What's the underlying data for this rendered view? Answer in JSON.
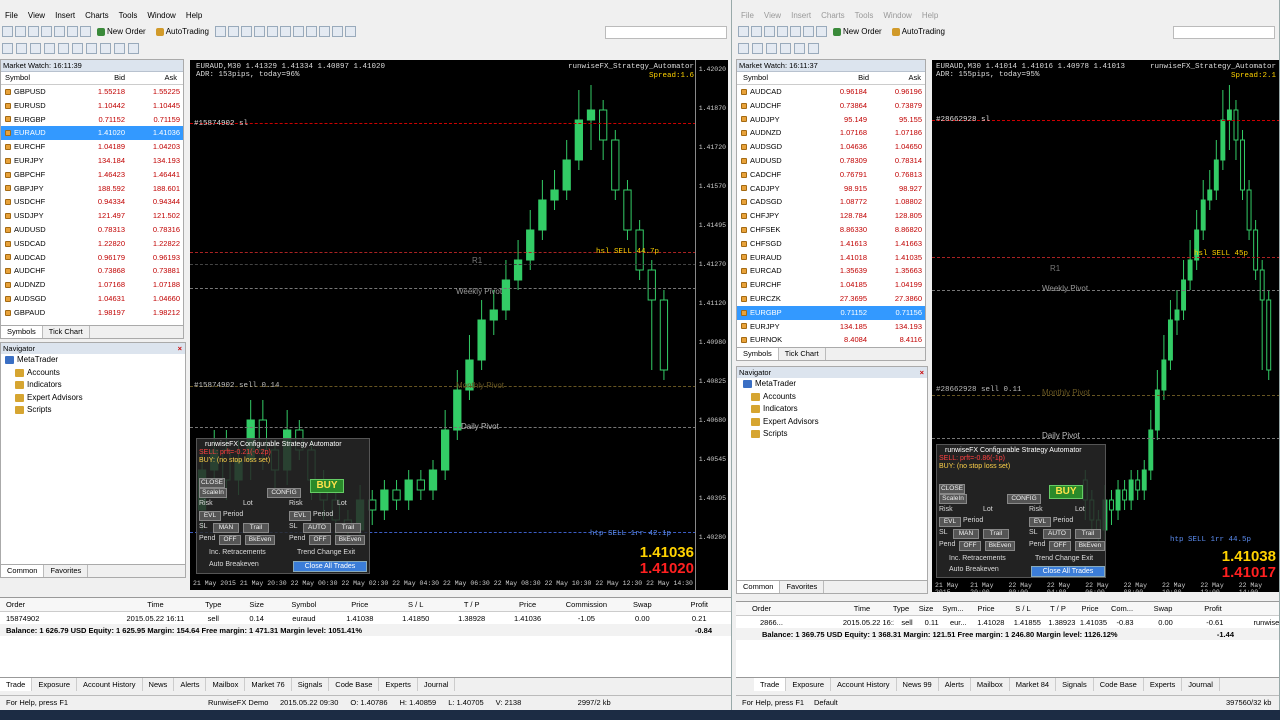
{
  "menu": [
    "File",
    "View",
    "Insert",
    "Charts",
    "Tools",
    "Window",
    "Help"
  ],
  "toolbar": {
    "new_order": "New Order",
    "autotrading": "AutoTrading"
  },
  "left": {
    "market_watch_title": "Market Watch: 16:11:39",
    "columns": {
      "symbol": "Symbol",
      "bid": "Bid",
      "ask": "Ask"
    },
    "rows": [
      {
        "s": "GBPUSD",
        "b": "1.55218",
        "a": "1.55225"
      },
      {
        "s": "EURUSD",
        "b": "1.10442",
        "a": "1.10445"
      },
      {
        "s": "EURGBP",
        "b": "0.71152",
        "a": "0.71159"
      },
      {
        "s": "EURAUD",
        "b": "1.41020",
        "a": "1.41036"
      },
      {
        "s": "EURCHF",
        "b": "1.04189",
        "a": "1.04203"
      },
      {
        "s": "EURJPY",
        "b": "134.184",
        "a": "134.193"
      },
      {
        "s": "GBPCHF",
        "b": "1.46423",
        "a": "1.46441"
      },
      {
        "s": "GBPJPY",
        "b": "188.592",
        "a": "188.601"
      },
      {
        "s": "USDCHF",
        "b": "0.94334",
        "a": "0.94344"
      },
      {
        "s": "USDJPY",
        "b": "121.497",
        "a": "121.502"
      },
      {
        "s": "AUDUSD",
        "b": "0.78313",
        "a": "0.78316"
      },
      {
        "s": "USDCAD",
        "b": "1.22820",
        "a": "1.22822"
      },
      {
        "s": "AUDCAD",
        "b": "0.96179",
        "a": "0.96193"
      },
      {
        "s": "AUDCHF",
        "b": "0.73868",
        "a": "0.73881"
      },
      {
        "s": "AUDNZD",
        "b": "1.07168",
        "a": "1.07188"
      },
      {
        "s": "AUDSGD",
        "b": "1.04631",
        "a": "1.04660"
      },
      {
        "s": "GBPAUD",
        "b": "1.98197",
        "a": "1.98212"
      }
    ],
    "tabs": [
      "Symbols",
      "Tick Chart"
    ],
    "navigator_title": "Navigator",
    "nav_items": [
      "MetaTrader",
      "Accounts",
      "Indicators",
      "Expert Advisors",
      "Scripts"
    ],
    "chart": {
      "header": "EURAUD,M30  1.41329 1.41334 1.40897 1.41020",
      "adr": "ADR: 153pips, today=96%",
      "ea": "runwiseFX_Strategy_Automator",
      "spread": "Spread:1.6",
      "order_lbl": "#15874902 sl",
      "hsl": "hsl SELL 44.7p",
      "htp": "htp SELL 1rr 42.1p",
      "r1": "R1",
      "weekly": "Weekly Pivot",
      "monthly": "Monthly Pivot",
      "daily": "Daily Pivot",
      "ask_big": "1.41036",
      "bid_big": "1.41020",
      "mini_lbl": "#15874902 sell 0.14",
      "axis": [
        "1.42020",
        "1.41870",
        "1.41720",
        "1.41570",
        "1.41495",
        "1.41270",
        "1.41120",
        "1.40980",
        "1.40825",
        "1.40680",
        "1.40545",
        "1.40395",
        "1.40280"
      ],
      "times": [
        "21 May 2015",
        "21 May 20:30",
        "22 May 00:30",
        "22 May 02:30",
        "22 May 04:30",
        "22 May 06:30",
        "22 May 08:30",
        "22 May 10:30",
        "22 May 12:30",
        "22 May 14:30"
      ],
      "candles": [
        {
          "o": 0.9,
          "c": 0.82,
          "h": 0.78,
          "l": 0.94
        },
        {
          "o": 0.82,
          "c": 0.78,
          "h": 0.74,
          "l": 0.86
        },
        {
          "o": 0.78,
          "c": 0.84,
          "h": 0.74,
          "l": 0.88
        },
        {
          "o": 0.84,
          "c": 0.8,
          "h": 0.76,
          "l": 0.87
        },
        {
          "o": 0.8,
          "c": 0.72,
          "h": 0.68,
          "l": 0.84
        },
        {
          "o": 0.72,
          "c": 0.78,
          "h": 0.68,
          "l": 0.82
        },
        {
          "o": 0.78,
          "c": 0.82,
          "h": 0.76,
          "l": 0.86
        },
        {
          "o": 0.82,
          "c": 0.74,
          "h": 0.7,
          "l": 0.85
        },
        {
          "o": 0.74,
          "c": 0.78,
          "h": 0.72,
          "l": 0.8
        },
        {
          "o": 0.78,
          "c": 0.84,
          "h": 0.76,
          "l": 0.88
        },
        {
          "o": 0.84,
          "c": 0.88,
          "h": 0.82,
          "l": 0.92
        },
        {
          "o": 0.88,
          "c": 0.92,
          "h": 0.86,
          "l": 0.95
        },
        {
          "o": 0.92,
          "c": 0.94,
          "h": 0.9,
          "l": 0.97
        },
        {
          "o": 0.94,
          "c": 0.88,
          "h": 0.85,
          "l": 0.96
        },
        {
          "o": 0.88,
          "c": 0.9,
          "h": 0.86,
          "l": 0.93
        },
        {
          "o": 0.9,
          "c": 0.86,
          "h": 0.84,
          "l": 0.92
        },
        {
          "o": 0.86,
          "c": 0.88,
          "h": 0.84,
          "l": 0.9
        },
        {
          "o": 0.88,
          "c": 0.84,
          "h": 0.82,
          "l": 0.9
        },
        {
          "o": 0.84,
          "c": 0.86,
          "h": 0.82,
          "l": 0.88
        },
        {
          "o": 0.86,
          "c": 0.82,
          "h": 0.8,
          "l": 0.88
        },
        {
          "o": 0.82,
          "c": 0.74,
          "h": 0.7,
          "l": 0.84
        },
        {
          "o": 0.74,
          "c": 0.66,
          "h": 0.62,
          "l": 0.76
        },
        {
          "o": 0.66,
          "c": 0.6,
          "h": 0.55,
          "l": 0.68
        },
        {
          "o": 0.6,
          "c": 0.52,
          "h": 0.48,
          "l": 0.62
        },
        {
          "o": 0.52,
          "c": 0.5,
          "h": 0.46,
          "l": 0.55
        },
        {
          "o": 0.5,
          "c": 0.44,
          "h": 0.4,
          "l": 0.52
        },
        {
          "o": 0.44,
          "c": 0.4,
          "h": 0.36,
          "l": 0.46
        },
        {
          "o": 0.4,
          "c": 0.34,
          "h": 0.3,
          "l": 0.42
        },
        {
          "o": 0.34,
          "c": 0.28,
          "h": 0.24,
          "l": 0.36
        },
        {
          "o": 0.28,
          "c": 0.26,
          "h": 0.22,
          "l": 0.3
        },
        {
          "o": 0.26,
          "c": 0.2,
          "h": 0.16,
          "l": 0.28
        },
        {
          "o": 0.2,
          "c": 0.12,
          "h": 0.06,
          "l": 0.22
        },
        {
          "o": 0.12,
          "c": 0.1,
          "h": 0.05,
          "l": 0.18
        },
        {
          "o": 0.1,
          "c": 0.16,
          "h": 0.08,
          "l": 0.2
        },
        {
          "o": 0.16,
          "c": 0.26,
          "h": 0.14,
          "l": 0.28
        },
        {
          "o": 0.26,
          "c": 0.34,
          "h": 0.24,
          "l": 0.36
        },
        {
          "o": 0.34,
          "c": 0.42,
          "h": 0.32,
          "l": 0.44
        },
        {
          "o": 0.42,
          "c": 0.48,
          "h": 0.4,
          "l": 0.62
        },
        {
          "o": 0.48,
          "c": 0.62,
          "h": 0.46,
          "l": 0.64
        }
      ],
      "panel": {
        "title": "runwiseFX Configurable Strategy Automator",
        "sell": "SELL: prft=-0.21(-0.2p)",
        "buy": "BUY: (no stop loss set)",
        "buy_btn": "BUY",
        "close": "CLOSE",
        "config": "CONFIG",
        "scalein": "ScaleIn",
        "risk": "Risk",
        "lot": "Lot",
        "evl": "EVL",
        "period": "Period",
        "sl": "SL",
        "man": "MAN",
        "auto": "AUTO",
        "trail": "Trail",
        "pend": "Pend",
        "off": "OFF",
        "bkeven": "BkEven",
        "inc": "Inc. Retracements",
        "trend": "Trend Change Exit",
        "auto_be": "Auto Breakeven",
        "close_all": "Close All Trades"
      }
    },
    "chart_tabs": [
      "Common",
      "Favorites"
    ],
    "terminal": {
      "cols": [
        "Order",
        "Time",
        "Type",
        "Size",
        "Symbol",
        "Price",
        "S / L",
        "T / P",
        "Price",
        "Commission",
        "Swap",
        "Profit"
      ],
      "row": [
        "15874902",
        "2015.05.22 16:11",
        "sell",
        "0.14",
        "euraud",
        "1.41038",
        "1.41850",
        "1.38928",
        "1.41036",
        "-1.05",
        "0.00",
        "0.21"
      ],
      "balance": "Balance: 1 626.79 USD  Equity: 1 625.95  Margin: 154.64  Free margin: 1 471.31  Margin level: 1051.41%",
      "balance_profit": "-0.84"
    },
    "bottom_tabs": [
      "Trade",
      "Exposure",
      "Account History",
      "News",
      "Alerts",
      "Mailbox",
      "Market 76",
      "Signals",
      "Code Base",
      "Experts",
      "Journal"
    ],
    "status": [
      "For Help, press F1",
      "RunwiseFX Demo",
      "2015.05.22 09:30",
      "O: 1.40786",
      "H: 1.40859",
      "L: 1.40705",
      "V: 2138",
      "2997/2 kb"
    ]
  },
  "right": {
    "market_watch_title": "Market Watch: 16:11:37",
    "columns": {
      "symbol": "Symbol",
      "bid": "Bid",
      "ask": "Ask"
    },
    "rows": [
      {
        "s": "AUDCAD",
        "b": "0.96184",
        "a": "0.96196"
      },
      {
        "s": "AUDCHF",
        "b": "0.73864",
        "a": "0.73879"
      },
      {
        "s": "AUDJPY",
        "b": "95.149",
        "a": "95.155"
      },
      {
        "s": "AUDNZD",
        "b": "1.07168",
        "a": "1.07186"
      },
      {
        "s": "AUDSGD",
        "b": "1.04636",
        "a": "1.04650"
      },
      {
        "s": "AUDUSD",
        "b": "0.78309",
        "a": "0.78314"
      },
      {
        "s": "CADCHF",
        "b": "0.76791",
        "a": "0.76813"
      },
      {
        "s": "CADJPY",
        "b": "98.915",
        "a": "98.927"
      },
      {
        "s": "CADSGD",
        "b": "1.08772",
        "a": "1.08802"
      },
      {
        "s": "CHFJPY",
        "b": "128.784",
        "a": "128.805"
      },
      {
        "s": "CHFSEK",
        "b": "8.86330",
        "a": "8.86820"
      },
      {
        "s": "CHFSGD",
        "b": "1.41613",
        "a": "1.41663"
      },
      {
        "s": "EURAUD",
        "b": "1.41018",
        "a": "1.41035"
      },
      {
        "s": "EURCAD",
        "b": "1.35639",
        "a": "1.35663"
      },
      {
        "s": "EURCHF",
        "b": "1.04185",
        "a": "1.04199"
      },
      {
        "s": "EURCZK",
        "b": "27.3695",
        "a": "27.3860"
      },
      {
        "s": "EURGBP",
        "b": "0.71152",
        "a": "0.71156"
      },
      {
        "s": "EURJPY",
        "b": "134.185",
        "a": "134.193"
      },
      {
        "s": "EURNOK",
        "b": "8.4084",
        "a": "8.4116"
      }
    ],
    "tabs": [
      "Symbols",
      "Tick Chart"
    ],
    "navigator_title": "Navigator",
    "nav_items": [
      "MetaTrader",
      "Accounts",
      "Indicators",
      "Expert Advisors",
      "Scripts"
    ],
    "chart": {
      "header": "EURAUD,M30  1.41014 1.41016 1.40978 1.41013",
      "adr": "ADR: 155pips, today=95%",
      "ea": "runwiseFX_Strategy_Automator",
      "spread": "Spread:2.1",
      "order_lbl": "#28662928 sl",
      "hsl": "hsl SELL 45p",
      "htp": "htp SELL 1rr 44.5p",
      "r1": "R1",
      "weekly": "Weekly Pivot",
      "monthly": "Monthly Pivot",
      "daily": "Daily Pivot",
      "ask_big": "1.41038",
      "bid_big": "1.41017",
      "mini_lbl": "#28662928 sell 0.11",
      "times": [
        "21 May 2015",
        "21 May 20:00",
        "22 May 00:00",
        "22 May 04:00",
        "22 May 06:00",
        "22 May 08:00",
        "22 May 10:00",
        "22 May 12:00",
        "22 May 14:00"
      ],
      "panel": {
        "title": "runwiseFX Configurable Strategy Automator",
        "sell": "SELL: prft=-0.86(-1p)",
        "buy": "BUY: (no stop loss set)",
        "buy_btn": "BUY",
        "close": "CLOSE",
        "config": "CONFIG",
        "scalein": "ScaleIn",
        "risk": "Risk",
        "lot": "Lot",
        "evl": "EVL",
        "period": "Period",
        "sl": "SL",
        "man": "MAN",
        "auto": "AUTO",
        "trail": "Trail",
        "pend": "Pend",
        "off": "OFF",
        "bkeven": "BkEven",
        "inc": "Inc. Retracements",
        "trend": "Trend Change Exit",
        "auto_be": "Auto Breakeven",
        "close_all": "Close All Trades"
      }
    },
    "chart_tabs": [
      "Common",
      "Favorites"
    ],
    "terminal": {
      "cols": [
        "Order",
        "Time",
        "Type",
        "Size",
        "Sym...",
        "Price",
        "S / L",
        "T / P",
        "Price",
        "Com...",
        "Swap",
        "Profit"
      ],
      "row": [
        "2866...",
        "2015.05.22 16:11",
        "sell",
        "0.11",
        "eur...",
        "1.41028",
        "1.41855",
        "1.38923",
        "1.41035",
        "-0.83",
        "0.00",
        "-0.61"
      ],
      "right_text": "runwise",
      "balance": "Balance: 1 369.75 USD  Equity: 1 368.31  Margin: 121.51  Free margin: 1 246.80  Margin level: 1126.12%",
      "balance_profit": "-1.44"
    },
    "bottom_tabs": [
      "Trade",
      "Exposure",
      "Account History",
      "News 99",
      "Alerts",
      "Mailbox",
      "Market 84",
      "Signals",
      "Code Base",
      "Experts",
      "Journal"
    ],
    "status": [
      "For Help, press F1",
      "Default",
      "397560/32 kb"
    ]
  },
  "colors": {
    "bull": "#33cc66",
    "bear": "#000000",
    "wick": "#33cc66",
    "sell_line": "#cc0000",
    "pivot": "#999999",
    "ask_price": "#ffd200",
    "bid_price": "#ff2020"
  }
}
